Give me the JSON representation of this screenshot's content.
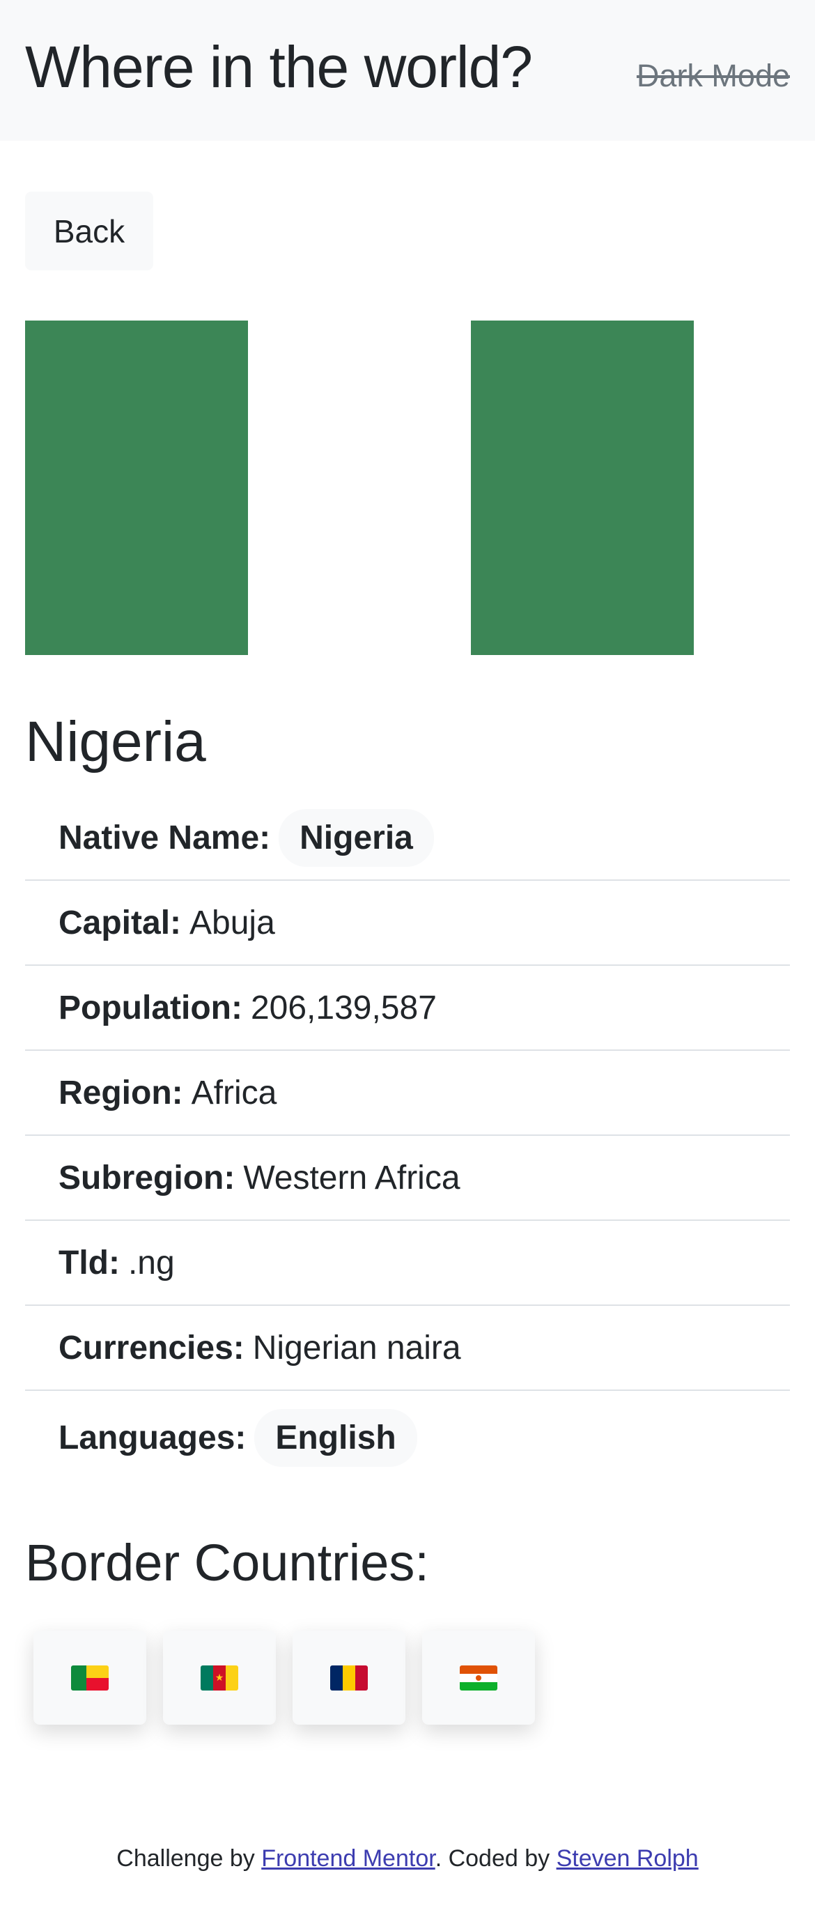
{
  "header": {
    "title": "Where in the world?",
    "dark_mode_label": "Dark Mode"
  },
  "back_label": "Back",
  "country": {
    "name": "Nigeria",
    "flag_colors": [
      "#3c8656",
      "#ffffff",
      "#3c8656"
    ],
    "details": [
      {
        "label": "Native Name:",
        "value": "Nigeria",
        "pill": true
      },
      {
        "label": "Capital:",
        "value": "Abuja"
      },
      {
        "label": "Population:",
        "value": "206,139,587"
      },
      {
        "label": "Region:",
        "value": "Africa"
      },
      {
        "label": "Subregion:",
        "value": "Western Africa"
      },
      {
        "label": "Tld:",
        "value": ".ng"
      },
      {
        "label": "Currencies:",
        "value": "Nigerian naira"
      },
      {
        "label": "Languages:",
        "value": "English",
        "pill": true
      }
    ]
  },
  "border_section": {
    "title": "Border Countries:",
    "countries": [
      {
        "name": "Benin",
        "icon": "benin-flag-icon"
      },
      {
        "name": "Cameroon",
        "icon": "cameroon-flag-icon"
      },
      {
        "name": "Chad",
        "icon": "chad-flag-icon"
      },
      {
        "name": "Niger",
        "icon": "niger-flag-icon"
      }
    ]
  },
  "footer": {
    "prefix": "Challenge by ",
    "link1": "Frontend Mentor",
    "middle": ". Coded by ",
    "link2": "Steven Rolph"
  }
}
